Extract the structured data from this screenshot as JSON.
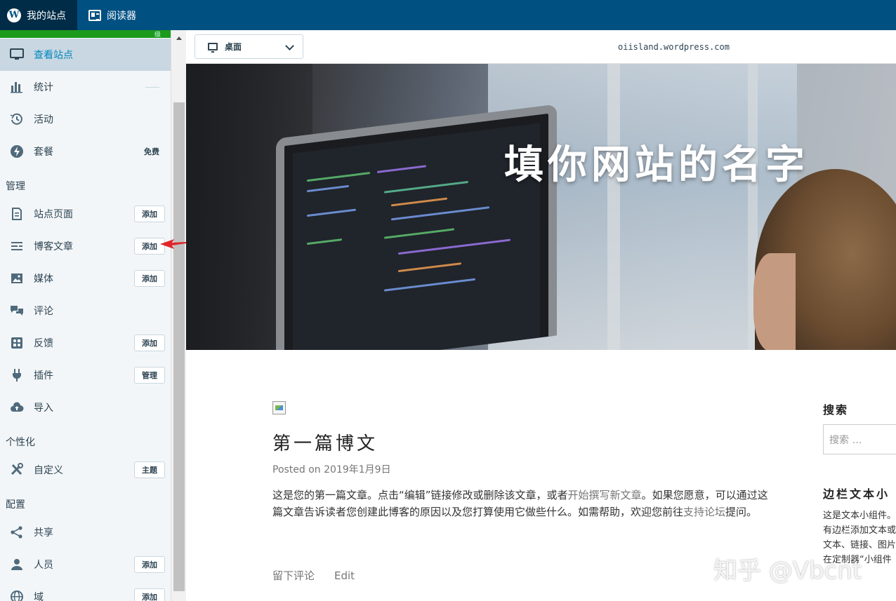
{
  "topbar": {
    "my_site": "我的站点",
    "reader": "阅读器"
  },
  "sidebar": {
    "progress_label": "级",
    "items": [
      {
        "label": "查看站点",
        "icon": "monitor-icon"
      },
      {
        "label": "统计",
        "icon": "bar-chart-icon"
      },
      {
        "label": "活动",
        "icon": "history-icon"
      },
      {
        "label": "套餐",
        "icon": "plan-icon",
        "badge": "免费"
      }
    ],
    "section_manage": "管理",
    "manage_items": [
      {
        "label": "站点页面",
        "icon": "pages-icon",
        "button": "添加"
      },
      {
        "label": "博客文章",
        "icon": "posts-icon",
        "button": "添加"
      },
      {
        "label": "媒体",
        "icon": "image-icon",
        "button": "添加"
      },
      {
        "label": "评论",
        "icon": "comments-icon"
      },
      {
        "label": "反馈",
        "icon": "feedback-icon",
        "button": "添加"
      },
      {
        "label": "插件",
        "icon": "plugin-icon",
        "button": "管理"
      },
      {
        "label": "导入",
        "icon": "cloud-upload-icon"
      }
    ],
    "section_personalize": "个性化",
    "personalize_items": [
      {
        "label": "自定义",
        "icon": "tools-icon",
        "button": "主题"
      }
    ],
    "section_configure": "配置",
    "configure_items": [
      {
        "label": "共享",
        "icon": "share-icon"
      },
      {
        "label": "人员",
        "icon": "user-icon",
        "button": "添加"
      },
      {
        "label": "域",
        "icon": "globe-icon",
        "button": "添加"
      }
    ]
  },
  "preview": {
    "device": "桌面",
    "url": "oiisland.wordpress.com"
  },
  "hero": {
    "site_title": "填你网站的名字"
  },
  "post": {
    "title": "第一篇博文",
    "meta_prefix": "Posted on ",
    "meta_date": "2019年1月9日",
    "body_1": "这是您的第一篇文章。点击“编辑”链接修改或删除该文章，或者",
    "body_link_1": "开始撰写新文章",
    "body_2": "。如果您愿意，可以通过这篇文章告诉读者您创建此博客的原因以及您打算使用它做些什么。如需帮助，欢迎您前往",
    "body_link_2": "支持论坛",
    "body_3": "提问。",
    "comment_link": "留下评论",
    "edit_link": "Edit"
  },
  "widgets": {
    "search_title": "搜索",
    "search_placeholder": "搜索 …",
    "text_title": "边栏文本小",
    "text_body": "这是文本小组件。有边栏添加文本或文本、链接、图片在定制器“小组件"
  },
  "watermark": "知乎 @Vbcnt",
  "colors": {
    "topbar": "#005082",
    "topbar_active": "#002c47",
    "sidebar_active": "#c8d7e1",
    "progress": "#1c9a1c",
    "arrow": "#e0262b"
  }
}
